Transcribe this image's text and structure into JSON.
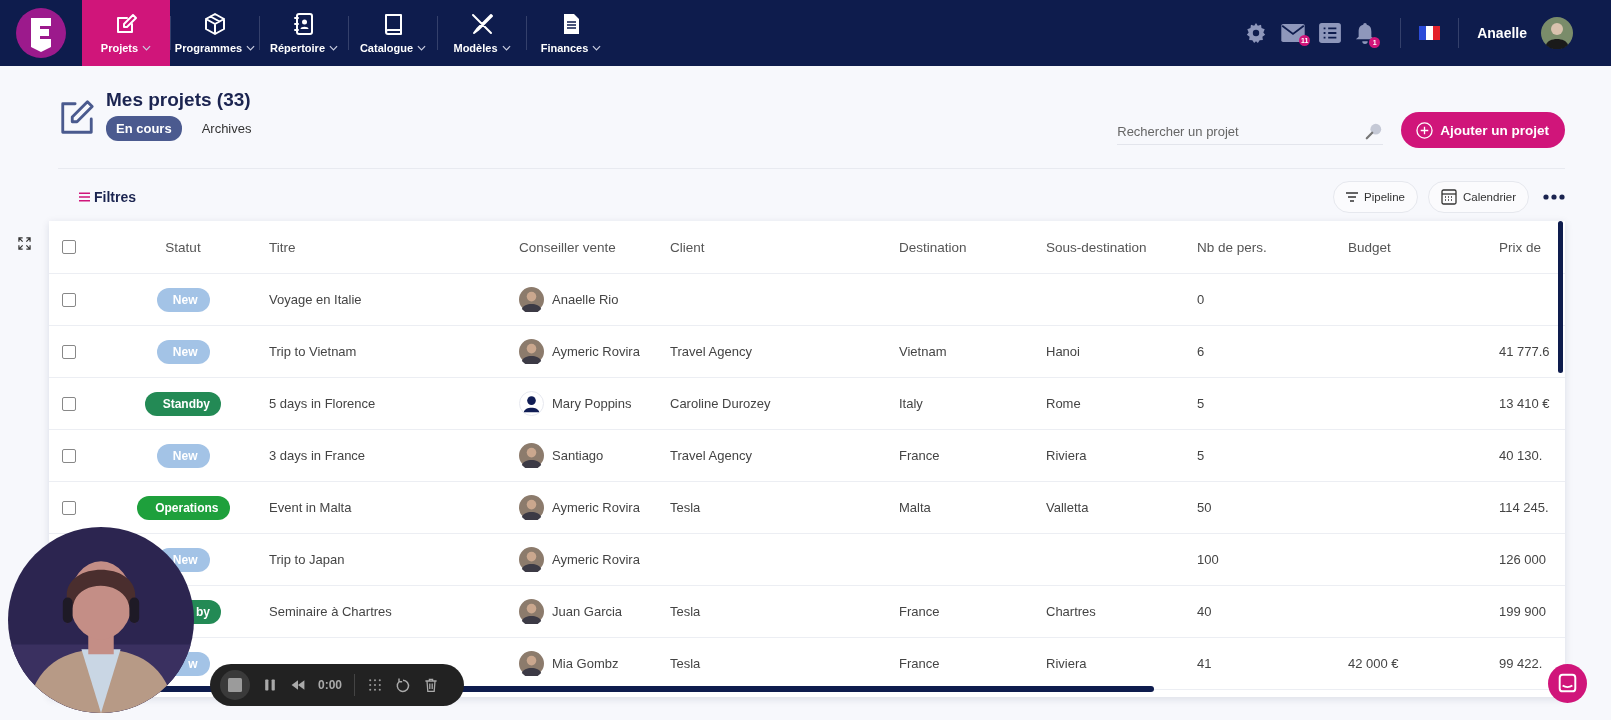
{
  "nav": {
    "items": [
      {
        "label": "Projets",
        "selected": true
      },
      {
        "label": "Programmes",
        "selected": false
      },
      {
        "label": "Répertoire",
        "selected": false
      },
      {
        "label": "Catalogue",
        "selected": false
      },
      {
        "label": "Modèles",
        "selected": false
      },
      {
        "label": "Finances",
        "selected": false
      }
    ],
    "mail_badge": "11",
    "bell_badge": "1",
    "user": "Anaelle"
  },
  "page": {
    "title": "Mes projets (33)",
    "tabs": [
      {
        "label": "En cours",
        "selected": true
      },
      {
        "label": "Archives",
        "selected": false
      }
    ],
    "search": {
      "placeholder": "Rechercher un projet"
    },
    "add_button": "Ajouter un projet",
    "filters": "Filtres",
    "views": [
      "Pipeline",
      "Calendrier"
    ]
  },
  "table": {
    "header_checked": false,
    "columns": [
      "Statut",
      "Titre",
      "Conseiller vente",
      "Client",
      "Destination",
      "Sous-destination",
      "Nb de pers.",
      "Budget",
      "Prix de"
    ],
    "rows": [
      {
        "checked": false,
        "status": {
          "label": "New",
          "kind": "new"
        },
        "title": "Voyage en Italie",
        "advisor": {
          "name": "Anaelle Rio"
        },
        "client": "",
        "destination": "",
        "sub_destination": "",
        "people": "0",
        "budget": "",
        "price": ""
      },
      {
        "checked": false,
        "status": {
          "label": "New",
          "kind": "new"
        },
        "title": "Trip to Vietnam",
        "advisor": {
          "name": "Aymeric Rovira"
        },
        "client": "Travel Agency",
        "destination": "Vietnam",
        "sub_destination": "Hanoi",
        "people": "6",
        "budget": "",
        "price": "41 777.6"
      },
      {
        "checked": false,
        "status": {
          "label": "Standby",
          "kind": "standby"
        },
        "title": "5 days in Florence",
        "advisor": {
          "name": "Mary Poppins",
          "kind": "placeholder"
        },
        "client": "Caroline Durozey",
        "destination": "Italy",
        "sub_destination": "Rome",
        "people": "5",
        "budget": "",
        "price": "13 410 €"
      },
      {
        "checked": false,
        "status": {
          "label": "New",
          "kind": "new"
        },
        "title": "3 days in France",
        "advisor": {
          "name": "Santiago"
        },
        "client": "Travel Agency",
        "destination": "France",
        "sub_destination": "Riviera",
        "people": "5",
        "budget": "",
        "price": "40 130."
      },
      {
        "checked": false,
        "status": {
          "label": "Operations",
          "kind": "operations"
        },
        "title": "Event in Malta",
        "advisor": {
          "name": "Aymeric Rovira"
        },
        "client": "Tesla",
        "destination": "Malta",
        "sub_destination": "Valletta",
        "people": "50",
        "budget": "",
        "price": "114 245."
      },
      {
        "status": {
          "label": "New",
          "kind": "new"
        },
        "title": "Trip to Japan",
        "advisor": {
          "name": "Aymeric Rovira"
        },
        "client": "",
        "destination": "",
        "sub_destination": "",
        "people": "100",
        "budget": "",
        "price": "126 000"
      },
      {
        "status": {
          "label": "by",
          "kind": "standby"
        },
        "title": "Seminaire à Chartres",
        "advisor": {
          "name": "Juan Garcia"
        },
        "client": "Tesla",
        "destination": "France",
        "sub_destination": "Chartres",
        "people": "40",
        "budget": "",
        "price": "199 900"
      },
      {
        "status": {
          "label": "w",
          "kind": "new"
        },
        "advisor": {
          "name": "Mia Gombz"
        },
        "client": "Tesla",
        "destination": "France",
        "sub_destination": "Riviera",
        "people": "41",
        "budget": "42 000 €",
        "price": "99 422."
      }
    ]
  },
  "recorder": {
    "time": "0:00"
  }
}
